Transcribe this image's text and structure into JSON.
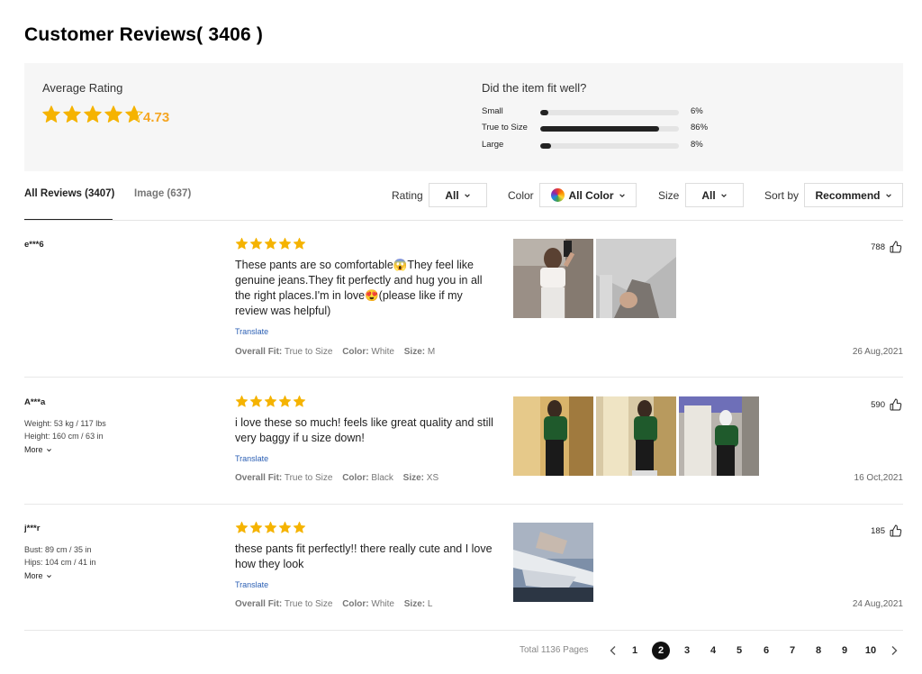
{
  "header": {
    "title": "Customer Reviews( 3406 )"
  },
  "summary": {
    "average_label": "Average Rating",
    "average_value": "4.73",
    "average_stars": 4.73,
    "fit_title": "Did the item fit well?",
    "fit": [
      {
        "label": "Small",
        "percent_text": "6%",
        "fraction": 0.06
      },
      {
        "label": "True to Size",
        "percent_text": "86%",
        "fraction": 0.86
      },
      {
        "label": "Large",
        "percent_text": "8%",
        "fraction": 0.08
      }
    ]
  },
  "tabs": [
    {
      "label": "All Reviews (3407)",
      "active": true
    },
    {
      "label": "Image (637)",
      "active": false
    }
  ],
  "filters": {
    "rating_label": "Rating",
    "rating_value": "All",
    "color_label": "Color",
    "color_value": "All Color",
    "size_label": "Size",
    "size_value": "All",
    "sort_label": "Sort by",
    "sort_value": "Recommend"
  },
  "reviews": [
    {
      "user": "e***6",
      "meta": [],
      "more": "",
      "stars": 5,
      "text": "These pants are so comfortable😱They feel like genuine jeans.They fit perfectly and hug you in all the right places.I'm in love😍(please like if my review was helpful)",
      "translate": "Translate",
      "fit_key": "Overall Fit:",
      "fit_val": "True to Size",
      "color_key": "Color:",
      "color_val": "White",
      "size_key": "Size:",
      "size_val": "M",
      "likes": "788",
      "date": "26 Aug,2021",
      "photo_count": 2
    },
    {
      "user": "A***a",
      "meta": [
        {
          "k": "Weight:",
          "v": "53 kg / 117 lbs"
        },
        {
          "k": "Height:",
          "v": "160 cm / 63 in"
        }
      ],
      "more": "More",
      "stars": 5,
      "text": "i love these so much! feels like great quality and still very baggy if u size down!",
      "translate": "Translate",
      "fit_key": "Overall Fit:",
      "fit_val": "True to Size",
      "color_key": "Color:",
      "color_val": "Black",
      "size_key": "Size:",
      "size_val": "XS",
      "likes": "590",
      "date": "16 Oct,2021",
      "photo_count": 3
    },
    {
      "user": "j***r",
      "meta": [
        {
          "k": "Bust:",
          "v": "89 cm / 35 in"
        },
        {
          "k": "Hips:",
          "v": "104 cm / 41 in"
        }
      ],
      "more": "More",
      "stars": 5,
      "text": "these pants fit perfectly!! there really cute and I love how they look",
      "translate": "Translate",
      "fit_key": "Overall Fit:",
      "fit_val": "True to Size",
      "color_key": "Color:",
      "color_val": "White",
      "size_key": "Size:",
      "size_val": "L",
      "likes": "185",
      "date": "24 Aug,2021",
      "photo_count": 1
    }
  ],
  "pagination": {
    "total": "Total 1136 Pages",
    "pages": [
      "1",
      "2",
      "3",
      "4",
      "5",
      "6",
      "7",
      "8",
      "9",
      "10"
    ],
    "current": "2"
  },
  "colors": {
    "star": "#f5b301",
    "rating_text": "#f5a623",
    "link": "#2b5fb4",
    "summary_bg": "#f6f6f6"
  },
  "icons": [
    "star-icon",
    "chevron-down-icon",
    "color-swatch-icon",
    "thumbs-up-icon",
    "chevron-left-icon",
    "chevron-right-icon"
  ]
}
